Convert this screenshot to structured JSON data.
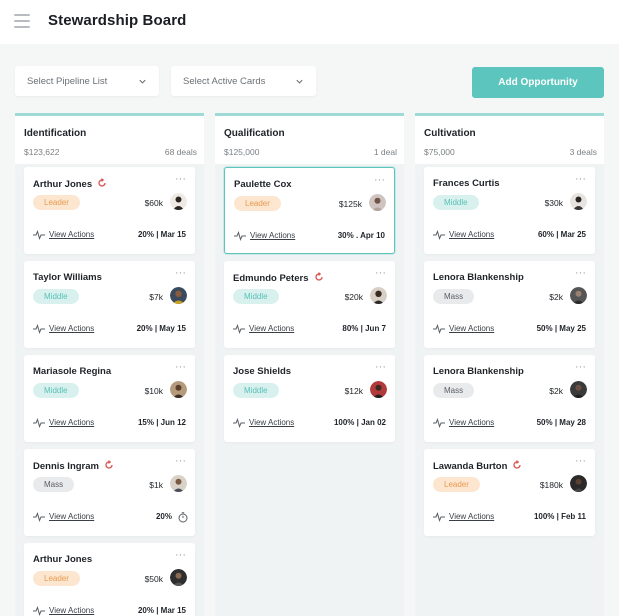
{
  "header": {
    "title": "Stewardship Board"
  },
  "filters": {
    "pipeline_placeholder": "Select Pipeline List",
    "cards_placeholder": "Select Active Cards"
  },
  "actions": {
    "add_label": "Add Opportunity"
  },
  "colors": {
    "accent": "#5cc6be",
    "leader": "#e79a52",
    "middle": "#57c0b7",
    "mass": "#5a5f66"
  },
  "columns": [
    {
      "title": "Identification",
      "amount": "$123,622",
      "count": "68 deals",
      "cards": [
        {
          "name": "Arthur Jones",
          "badge": "Leader",
          "amount": "$60k",
          "link": "View Actions",
          "progress": "20% | Mar 15"
        },
        {
          "name": "Taylor Williams",
          "badge": "Middle",
          "amount": "$7k",
          "link": "View Actions",
          "progress": "20% | May 15"
        },
        {
          "name": "Mariasole Regina",
          "badge": "Middle",
          "amount": "$10k",
          "link": "View Actions",
          "progress": "15% | Jun 12"
        },
        {
          "name": "Dennis Ingram",
          "badge": "Mass",
          "amount": "$1k",
          "link": "View Actions",
          "progress": "20%"
        },
        {
          "name": "Arthur Jones",
          "badge": "Leader",
          "amount": "$50k",
          "link": "View Actions",
          "progress": "20% | Mar 15"
        }
      ]
    },
    {
      "title": "Qualification",
      "amount": "$125,000",
      "count": "1 deal",
      "cards": [
        {
          "name": "Paulette Cox",
          "badge": "Leader",
          "amount": "$125k",
          "link": "View Actions",
          "progress": "30% . Apr 10"
        },
        {
          "name": "Edmundo Peters",
          "badge": "Middle",
          "amount": "$20k",
          "link": "View Actions",
          "progress": "80% | Jun 7"
        },
        {
          "name": "Jose Shields",
          "badge": "Middle",
          "amount": "$12k",
          "link": "View Actions",
          "progress": "100% | Jan 02"
        }
      ]
    },
    {
      "title": "Cultivation",
      "amount": "$75,000",
      "count": "3 deals",
      "cards": [
        {
          "name": "Frances Curtis",
          "badge": "Middle",
          "amount": "$30k",
          "link": "View Actions",
          "progress": "60% | Mar 25"
        },
        {
          "name": "Lenora Blankenship",
          "badge": "Mass",
          "amount": "$2k",
          "link": "View Actions",
          "progress": "50% | May 25"
        },
        {
          "name": "Lenora Blankenship",
          "badge": "Mass",
          "amount": "$2k",
          "link": "View Actions",
          "progress": "50% | May 28"
        },
        {
          "name": "Lawanda Burton",
          "badge": "Leader",
          "amount": "$180k",
          "link": "View Actions",
          "progress": "100% | Feb 11"
        }
      ]
    }
  ]
}
